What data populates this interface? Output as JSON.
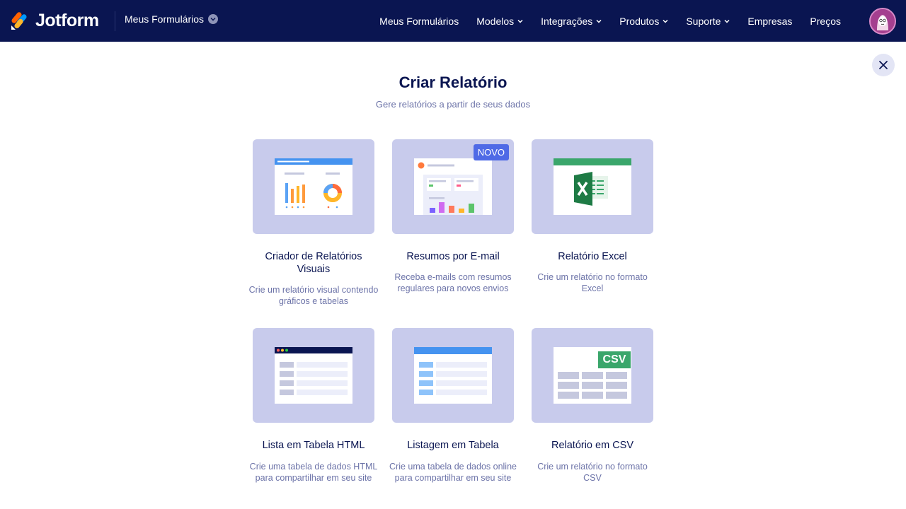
{
  "nav": {
    "brand": "Jotform",
    "my_forms_dropdown": "Meus Formulários",
    "links": [
      {
        "label": "Meus Formulários",
        "has_caret": false
      },
      {
        "label": "Modelos",
        "has_caret": true
      },
      {
        "label": "Integrações",
        "has_caret": true
      },
      {
        "label": "Produtos",
        "has_caret": true
      },
      {
        "label": "Suporte",
        "has_caret": true
      },
      {
        "label": "Empresas",
        "has_caret": false
      },
      {
        "label": "Preços",
        "has_caret": false
      }
    ]
  },
  "page": {
    "title": "Criar Relatório",
    "subtitle": "Gere relatórios a partir de seus dados"
  },
  "cards": [
    {
      "title": "Criador de Relatórios Visuais",
      "desc": "Crie um relatório visual contendo gráficos e tabelas",
      "icon": "visual-report-icon"
    },
    {
      "title": "Resumos por E-mail",
      "desc": "Receba e-mails com resumos regulares para novos envios",
      "icon": "email-digest-icon",
      "badge": "NOVO"
    },
    {
      "title": "Relatório Excel",
      "desc": "Crie um relatório no formato Excel",
      "icon": "excel-icon"
    },
    {
      "title": "Lista em Tabela HTML",
      "desc": "Crie uma tabela de dados HTML para compartilhar em seu site",
      "icon": "html-table-icon"
    },
    {
      "title": "Listagem em Tabela",
      "desc": "Crie uma tabela de dados online para compartilhar em seu site",
      "icon": "table-listing-icon"
    },
    {
      "title": "Relatório em CSV",
      "desc": "Crie um relatório no formato CSV",
      "icon": "csv-icon",
      "badge": "CSV"
    }
  ],
  "colors": {
    "nav_bg": "#0a1551",
    "card_bg": "#c8cbec",
    "title": "#0a1551",
    "muted": "#6c73a8",
    "accent_blue": "#4f6ae6",
    "excel_green": "#3aa66b"
  }
}
